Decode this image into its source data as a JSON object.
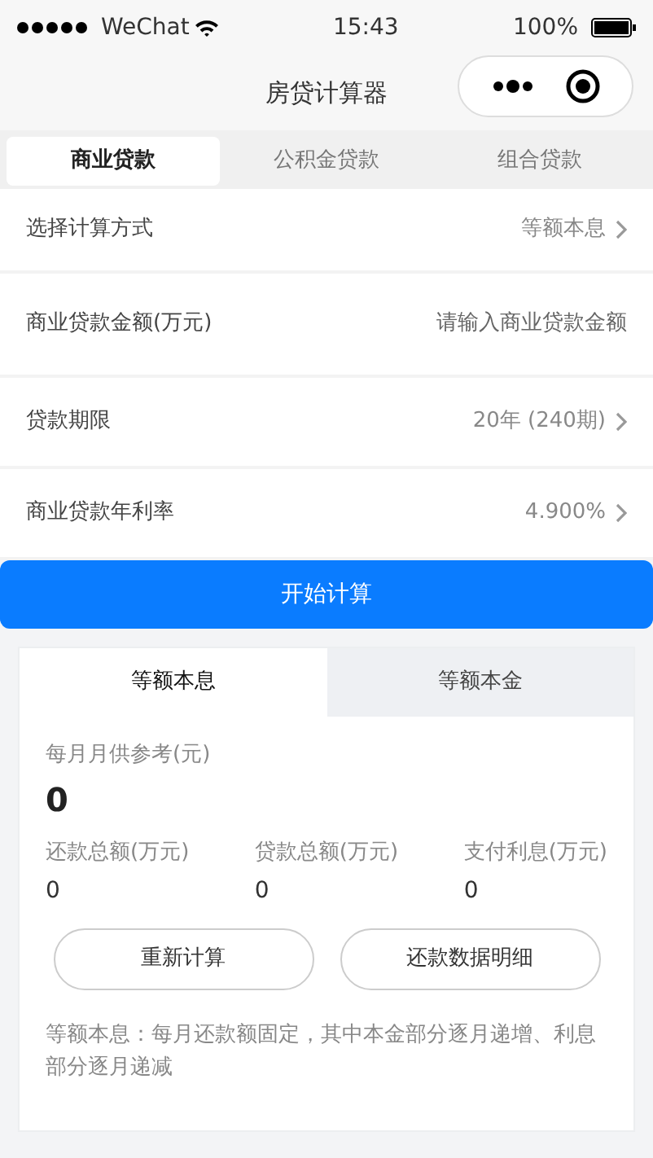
{
  "status_bar": {
    "carrier": "WeChat",
    "time": "15:43",
    "battery": "100%"
  },
  "nav_bar": {
    "title": "房贷计算器"
  },
  "loan_tabs": [
    {
      "label": "商业贷款",
      "selected": true
    },
    {
      "label": "公积金贷款",
      "selected": false
    },
    {
      "label": "组合贷款",
      "selected": false
    }
  ],
  "form_rows": [
    {
      "kind": "select",
      "label": "选择计算方式",
      "value": "等额本息"
    },
    {
      "kind": "input",
      "label": "商业贷款金额(万元)",
      "placeholder": "请输入商业贷款金额"
    },
    {
      "kind": "select",
      "label": "贷款期限",
      "value": "20年 (240期)"
    },
    {
      "kind": "select",
      "label": "商业贷款年利率",
      "value": "4.900%"
    }
  ],
  "calculate_button": "开始计算",
  "result": {
    "tabs": [
      {
        "label": "等额本息",
        "selected": true
      },
      {
        "label": "等额本金",
        "selected": false
      }
    ],
    "monthly_label": "每月月供参考(元)",
    "monthly_value": "0",
    "stats": [
      {
        "label": "还款总额(万元)",
        "value": "0"
      },
      {
        "label": "贷款总额(万元)",
        "value": "0"
      },
      {
        "label": "支付利息(万元)",
        "value": "0"
      }
    ],
    "buttons": [
      "重新计算",
      "还款数据明细"
    ],
    "note": "等额本息：每月还款额固定，其中本金部分逐月递增、利息部分逐月递减"
  }
}
